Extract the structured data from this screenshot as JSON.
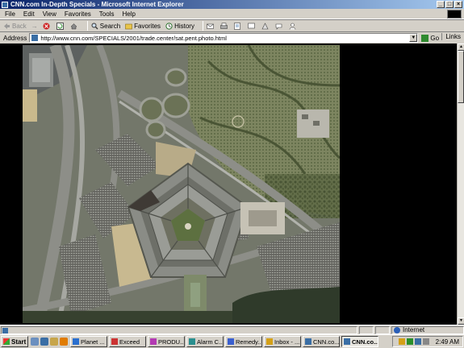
{
  "window": {
    "title": "CNN.com In-Depth Specials - Microsoft Internet Explorer",
    "controls": [
      "_",
      "□",
      "×"
    ]
  },
  "menu": [
    "File",
    "Edit",
    "View",
    "Favorites",
    "Tools",
    "Help"
  ],
  "toolbar": {
    "back": "Back",
    "forward": "→",
    "search": "Search",
    "favorites": "Favorites",
    "history": "History"
  },
  "address": {
    "label": "Address",
    "url": "http://www.cnn.com/SPECIALS/2001/trade.center/sat.pent.photo.html",
    "go": "Go",
    "links": "Links"
  },
  "content": {
    "image_icon": "satellite-photo"
  },
  "status": {
    "zone": "Internet"
  },
  "taskbar": {
    "start": "Start",
    "tasks": [
      {
        "label": "Planet ...",
        "color": "#2a6fcf"
      },
      {
        "label": "Exceed",
        "color": "#c33"
      },
      {
        "label": "PRODU...",
        "color": "#b33ab3"
      },
      {
        "label": "Alarm C...",
        "color": "#2a8f8f"
      },
      {
        "label": "Remedy...",
        "color": "#3a5fcf"
      },
      {
        "label": "Inbox - ...",
        "color": "#d4a017"
      },
      {
        "label": "CNN.co...",
        "color": "#3a6ea5"
      },
      {
        "label": "CNN.co...",
        "color": "#3a6ea5",
        "active": true
      }
    ],
    "clock": "2:49 AM"
  },
  "colors": {
    "titlebar_start": "#0a246a",
    "titlebar_end": "#a6caf0",
    "chrome": "#d4d0c8"
  }
}
